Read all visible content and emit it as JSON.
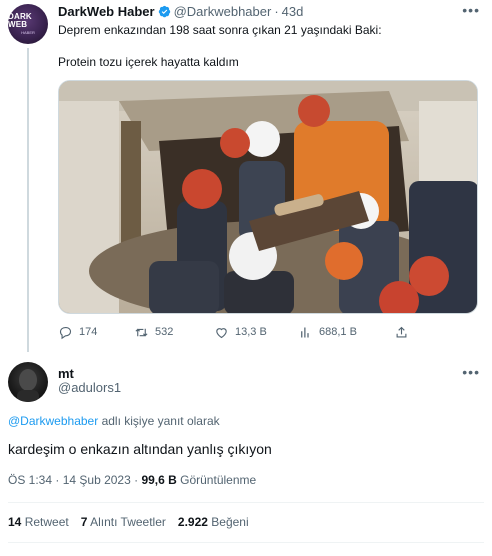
{
  "original_tweet": {
    "author_name": "DarkWeb Haber",
    "author_handle": "@Darkwebhaber",
    "separator": "·",
    "time_ago": "43d",
    "avatar_logo": "DARK WEB",
    "avatar_logo_sub": "HABER",
    "text_line1": "Deprem enkazından 198 saat sonra çıkan 21 yaşındaki Baki:",
    "text_line2": "Protein tozu içerek hayatta kaldım",
    "actions": {
      "replies": "174",
      "retweets": "532",
      "likes": "13,3 B",
      "views": "688,1 B"
    }
  },
  "reply_tweet": {
    "author_name": "mt",
    "author_handle": "@adulors1",
    "reply_to_handle": "@Darkwebhaber",
    "reply_to_suffix": " adlı kişiye yanıt olarak",
    "text": "kardeşim o enkazın altından yanlış çıkıyon",
    "time": "ÖS 1:34",
    "dot": " · ",
    "date": "14 Şub 2023",
    "views_count": "99,6 B",
    "views_label": " Görüntülenme",
    "stats": [
      {
        "count": "14",
        "label": " Retweet"
      },
      {
        "count": "7",
        "label": " Alıntı Tweetler"
      },
      {
        "count": "2.922",
        "label": " Beğeni"
      }
    ]
  },
  "icons": [
    "verified-badge-icon",
    "more-icon",
    "reply-icon",
    "retweet-icon",
    "like-icon",
    "views-icon",
    "share-icon"
  ],
  "colors": {
    "accent": "#1d9bf0",
    "muted": "#536471",
    "text": "#0f1419",
    "border": "#cfd9de"
  }
}
